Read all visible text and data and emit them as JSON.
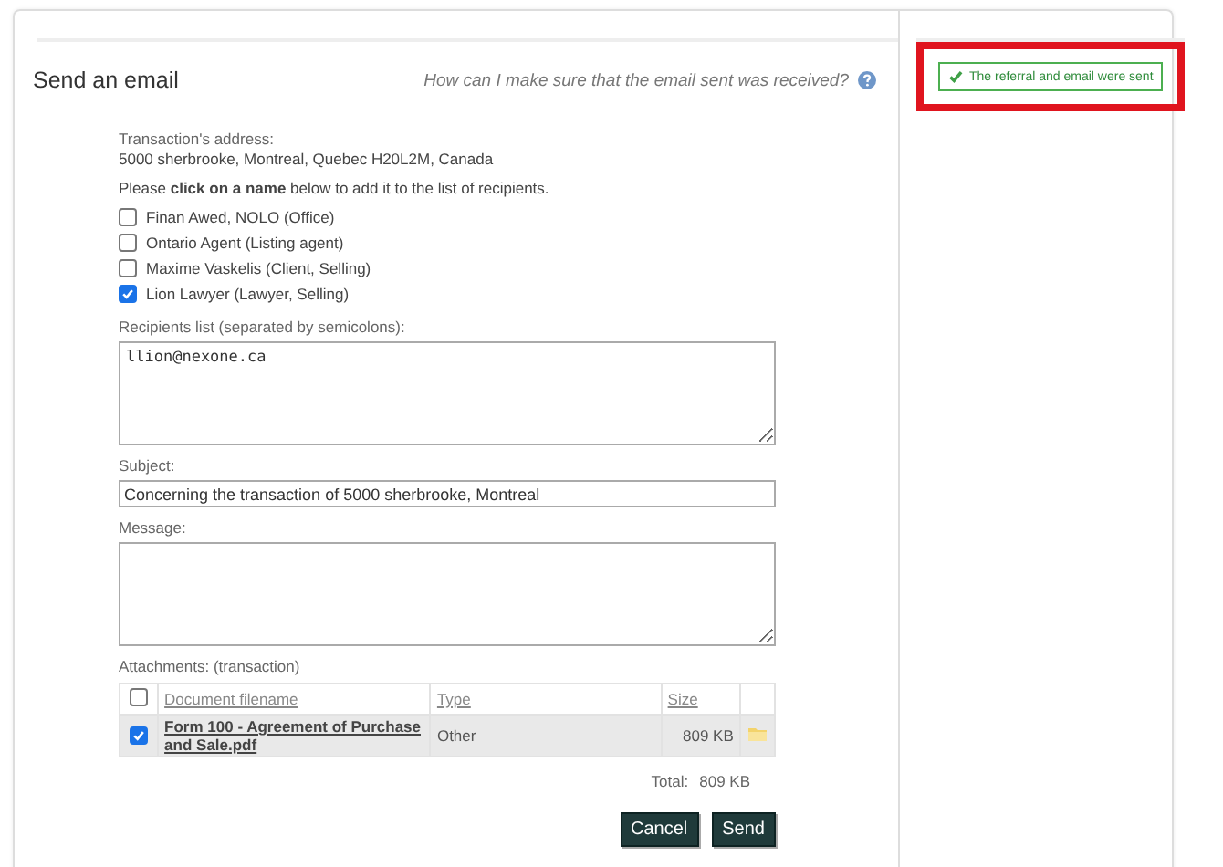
{
  "title": "Send an email",
  "help": {
    "text": "How can I make sure that the email sent was received?"
  },
  "notification": {
    "text": "The referral and email were sent",
    "highlighted": true
  },
  "address_label": "Transaction's address:",
  "address": "5000 sherbrooke, Montreal, Quebec H20L2M, Canada",
  "instructions": "Please **click on a name** below to add it to the list of recipients.",
  "contacts": [
    {
      "label": "Finan Awed, NOLO (Office)",
      "checked": false
    },
    {
      "label": "Ontario Agent (Listing agent)",
      "checked": false
    },
    {
      "label": "Maxime Vaskelis (Client, Selling)",
      "checked": false
    },
    {
      "label": "Lion Lawyer (Lawyer, Selling)",
      "checked": true
    }
  ],
  "recipients": {
    "label": "Recipients list (separated by semicolons):",
    "value": "llion@nexone.ca"
  },
  "subject": {
    "label": "Subject:",
    "value": "Concerning the transaction of 5000 sherbrooke, Montreal"
  },
  "message": {
    "label": "Message:"
  },
  "attachments": {
    "label": "Attachments: (transaction)",
    "select_all_checked": false,
    "columns": [
      "Document filename",
      "Type",
      "Size"
    ],
    "rows": [
      {
        "filename": "Form 100 - Agreement of Purchase and Sale.pdf",
        "type": "Other",
        "size": "809 KB",
        "checked": true
      }
    ],
    "total_label": "Total:",
    "total": "809 KB"
  },
  "buttons": [
    "Cancel",
    "Send"
  ]
}
